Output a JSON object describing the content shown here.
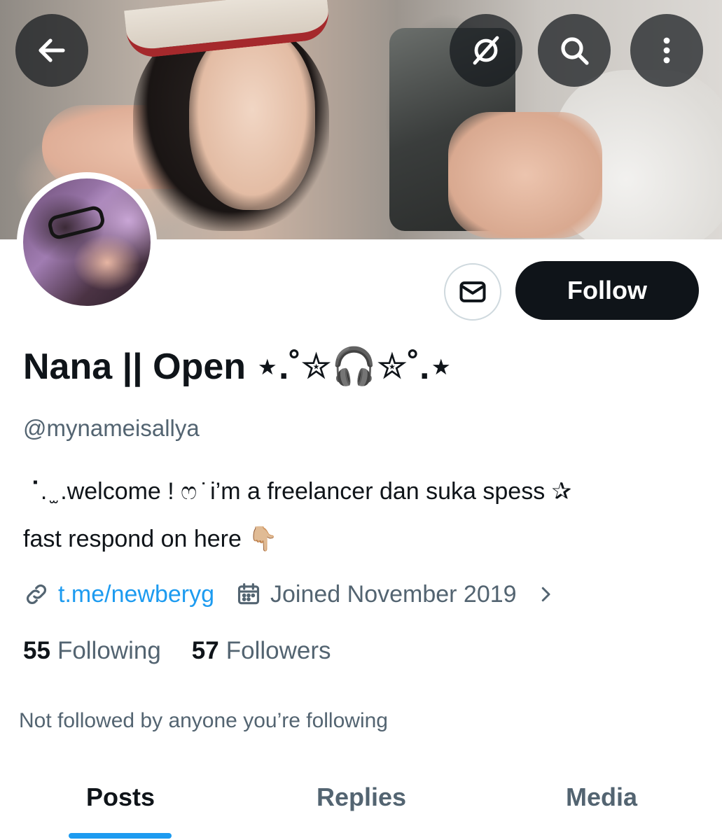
{
  "header": {
    "back_icon": "arrow-left-icon",
    "grok_icon": "grok-icon",
    "search_icon": "search-icon",
    "more_icon": "more-vertical-icon"
  },
  "profile": {
    "display_name": "Nana || Open ⋆.˚✮🎧✮˚.⋆",
    "handle": "@mynameisallya",
    "bio_line1": "⠈. ̫ .welcome ! ෆ ̇ i’m a freelancer dan suka spess ✰",
    "bio_line2": "fast respond on here 👇🏼",
    "link_text": "t.me/newberyg",
    "joined_text": "Joined November 2019",
    "following_count": "55",
    "following_label": "Following",
    "followers_count": "57",
    "followers_label": "Followers",
    "followed_by_text": "Not followed by anyone you’re following"
  },
  "actions": {
    "message_icon": "envelope-icon",
    "follow_label": "Follow"
  },
  "tabs": [
    {
      "label": "Posts",
      "active": true
    },
    {
      "label": "Replies",
      "active": false
    },
    {
      "label": "Media",
      "active": false
    }
  ],
  "colors": {
    "accent": "#1d9bf0",
    "primary_text": "#0f1419",
    "secondary_text": "#536471",
    "follow_button_bg": "#0f1419"
  }
}
